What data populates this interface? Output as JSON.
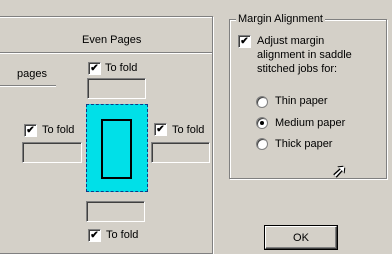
{
  "left_panel": {
    "header": "Even Pages",
    "pages_label": "pages",
    "to_fold_top": {
      "label": "To fold",
      "checked": true,
      "mark": "✔"
    },
    "to_fold_left": {
      "label": "To fold",
      "checked": true,
      "mark": "✔"
    },
    "to_fold_right": {
      "label": "To fold",
      "checked": true,
      "mark": "✔"
    },
    "to_fold_bottom": {
      "label": "To fold",
      "checked": true,
      "mark": "✔"
    }
  },
  "margin_alignment": {
    "title": "Margin Alignment",
    "adjust_checkbox": {
      "mark": "✔",
      "checked": true,
      "line1": "Adjust margin",
      "line2": "alignment in saddle",
      "line3": "stitched jobs for:"
    },
    "options": [
      {
        "label": "Thin paper",
        "selected": false
      },
      {
        "label": "Medium paper",
        "selected": true
      },
      {
        "label": "Thick paper",
        "selected": false
      }
    ]
  },
  "ok_button": "OK",
  "colors": {
    "preview_fill": "#00e0e8",
    "face": "#d4d0c8"
  },
  "cursor_icon": "arrow-cursor-icon"
}
